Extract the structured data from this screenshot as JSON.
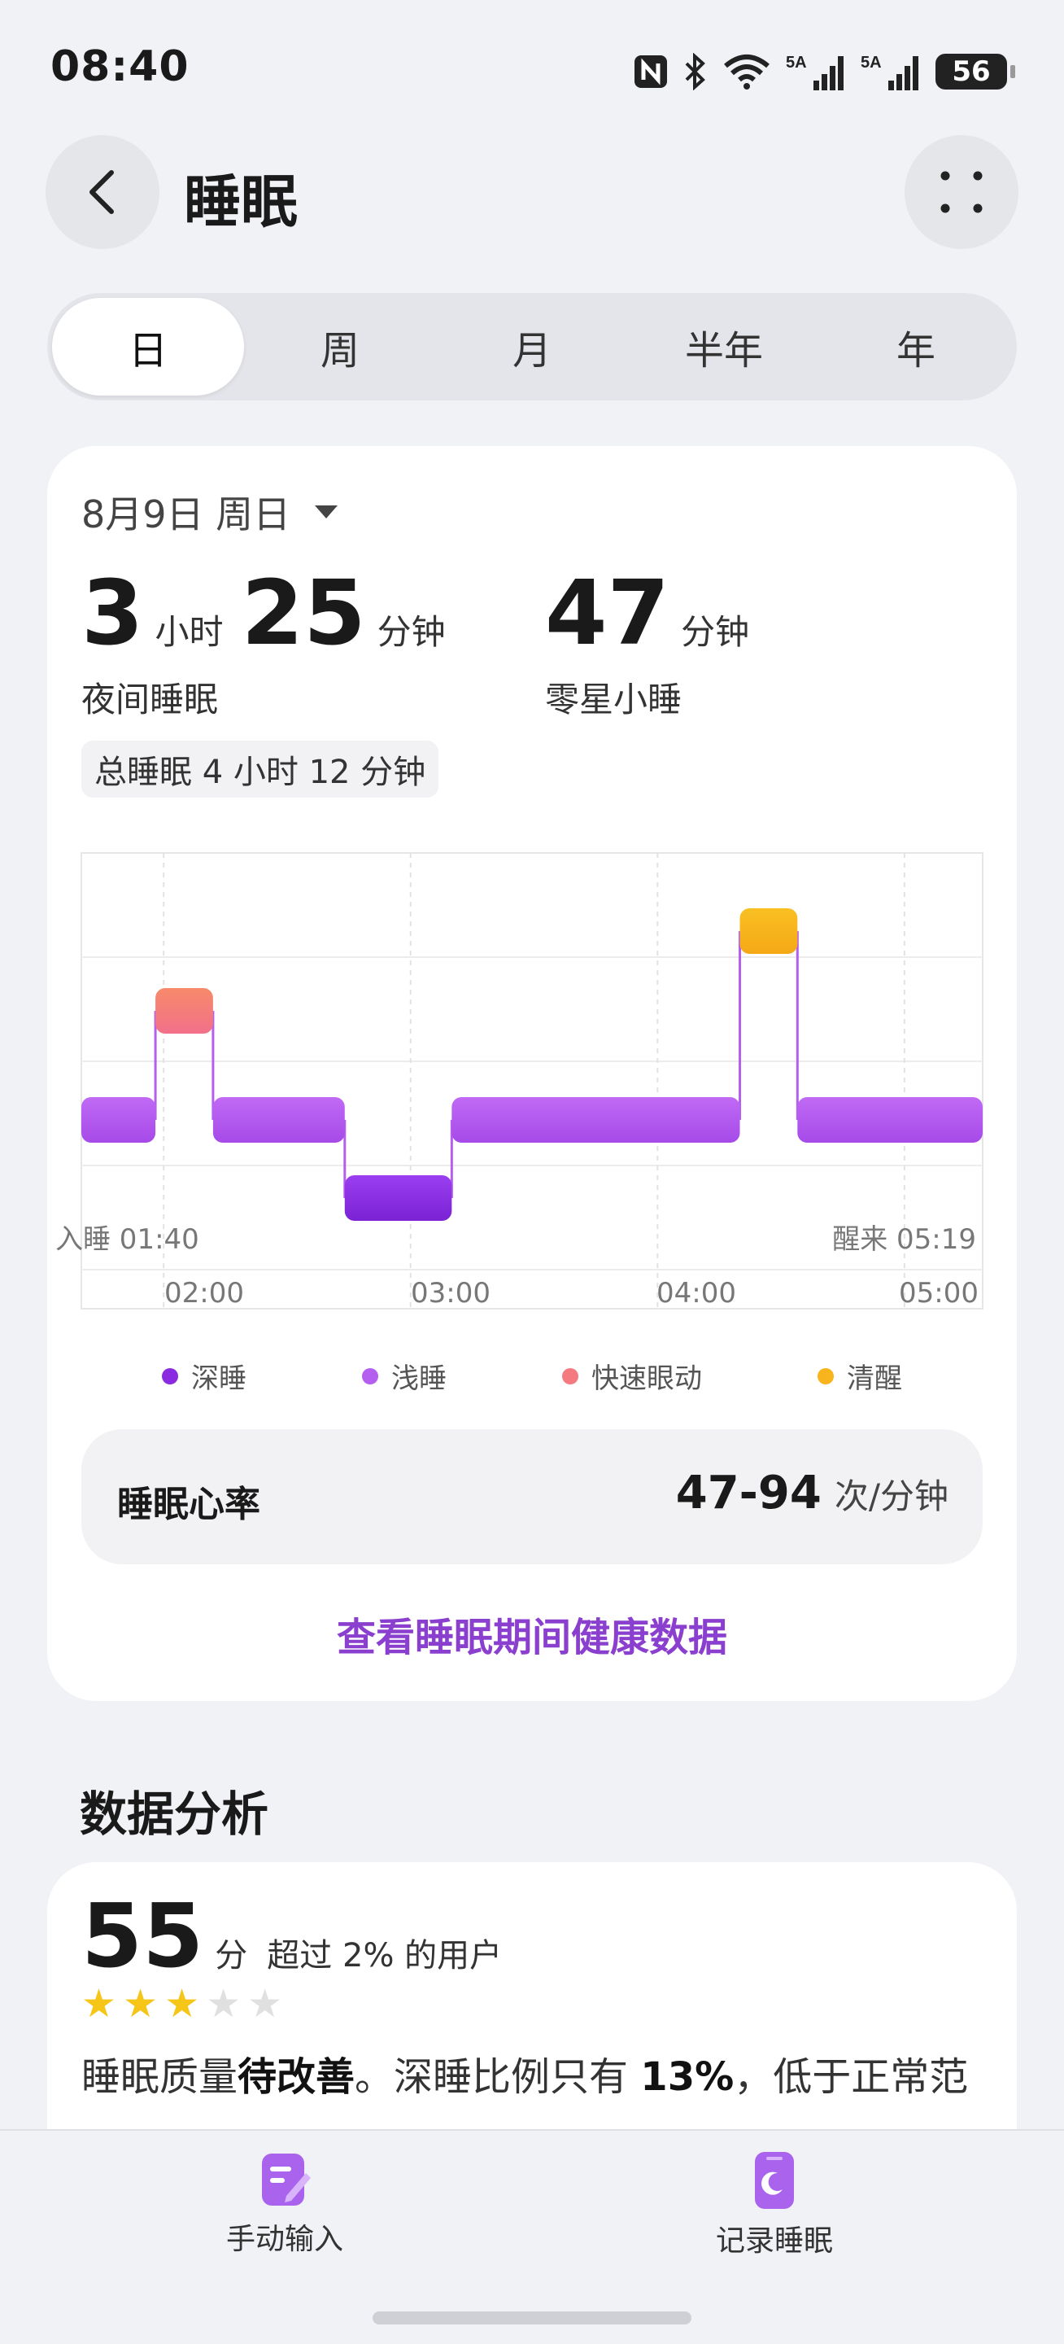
{
  "status_bar": {
    "time": "08:40",
    "battery": "56",
    "signal_labels": [
      "5A",
      "5A"
    ]
  },
  "header": {
    "title": "睡眠"
  },
  "period_tabs": [
    {
      "label": "日",
      "active": true
    },
    {
      "label": "周",
      "active": false
    },
    {
      "label": "月",
      "active": false
    },
    {
      "label": "半年",
      "active": false
    },
    {
      "label": "年",
      "active": false
    }
  ],
  "summary": {
    "date": "8月9日 周日",
    "night": {
      "hours": "3",
      "hours_unit": "小时",
      "minutes": "25",
      "minutes_unit": "分钟",
      "label": "夜间睡眠"
    },
    "nap": {
      "minutes": "47",
      "minutes_unit": "分钟",
      "label": "零星小睡"
    },
    "total": "总睡眠 4 小时 12 分钟"
  },
  "chart_data": {
    "type": "sleep-stage-timeline",
    "start_label": "入睡 01:40",
    "end_label": "醒来 05:19",
    "start": "01:40",
    "end": "05:19",
    "x_ticks": [
      "02:00",
      "03:00",
      "04:00",
      "05:00"
    ],
    "stages": [
      "深睡",
      "浅睡",
      "快速眼动",
      "清醒"
    ],
    "segments": [
      {
        "stage": "浅睡",
        "start": "01:40",
        "end": "01:58"
      },
      {
        "stage": "快速眼动",
        "start": "01:58",
        "end": "02:12"
      },
      {
        "stage": "浅睡",
        "start": "02:12",
        "end": "02:44"
      },
      {
        "stage": "深睡",
        "start": "02:44",
        "end": "03:10"
      },
      {
        "stage": "浅睡",
        "start": "03:10",
        "end": "04:20"
      },
      {
        "stage": "清醒",
        "start": "04:20",
        "end": "04:34"
      },
      {
        "stage": "浅睡",
        "start": "04:34",
        "end": "05:19"
      }
    ],
    "colors": {
      "深睡": "#8a2be2",
      "浅睡": "#b45ff0",
      "快速眼动": "#f47a80",
      "清醒": "#f7b41c"
    }
  },
  "legend": [
    {
      "label": "深睡",
      "color": "#8a2be2"
    },
    {
      "label": "浅睡",
      "color": "#b45ff0"
    },
    {
      "label": "快速眼动",
      "color": "#f47a80"
    },
    {
      "label": "清醒",
      "color": "#f7b41c"
    }
  ],
  "heart_rate": {
    "label": "睡眠心率",
    "value": "47-94",
    "unit": "次/分钟"
  },
  "health_link": "查看睡眠期间健康数据",
  "analysis": {
    "section_title": "数据分析",
    "score": "55",
    "score_unit": "分",
    "score_desc": "超过 2% 的用户",
    "stars": 3,
    "stars_total": 5,
    "text_1": "睡眠质量",
    "text_2": "待改善",
    "text_3": "。深睡比例只有 ",
    "text_4": "13%",
    "text_5": "，低于正常范"
  },
  "bottom_bar": {
    "manual_input": "手动输入",
    "record_sleep": "记录睡眠"
  },
  "accent_color": "#8a3fcf"
}
